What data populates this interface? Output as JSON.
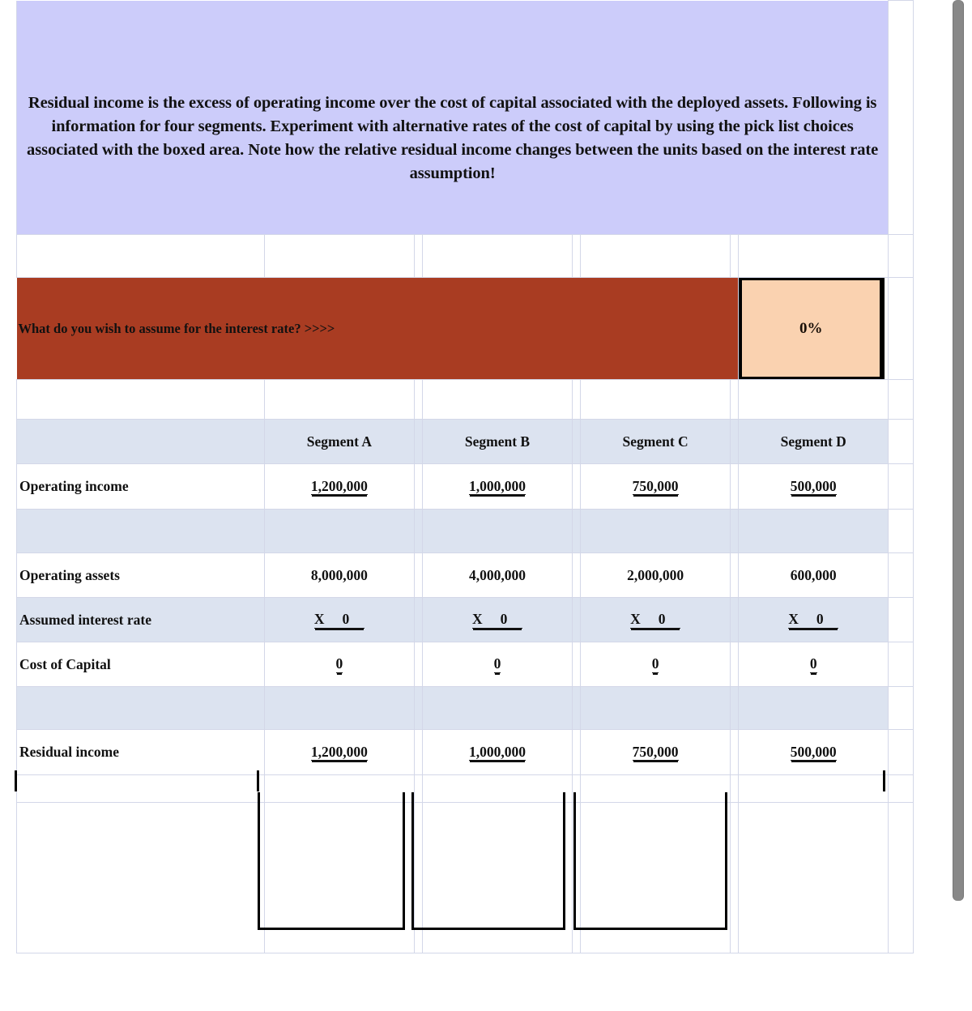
{
  "colors": {
    "banner_bg": "#CCCCFA",
    "question_band_bg": "#A93C22",
    "input_box_bg": "#FAD2B0",
    "shaded_row_bg": "#DCE3F0",
    "grid_line": "#D3D7E8",
    "box_border": "#000000"
  },
  "banner": {
    "text": "Residual income is the excess of operating income over the cost of capital associated with the deployed assets.  Following is information for four segments.  Experiment with alternative rates of the cost of capital by using the pick list choices associated with the boxed area.  Note how the relative residual income changes between the units based on the interest rate assumption!"
  },
  "question_row": {
    "prompt": "What do you wish to assume for the interest rate?  >>>>",
    "input_value": "0%"
  },
  "table": {
    "column_headers": [
      "",
      "Segment A",
      "Segment B",
      "Segment C",
      "Segment D"
    ],
    "rows": [
      {
        "label": "Operating income",
        "values": [
          "1,200,000",
          "1,000,000",
          "750,000",
          "500,000"
        ],
        "style": "double-underline"
      },
      {
        "label": "Operating assets",
        "values": [
          "8,000,000",
          "4,000,000",
          "2,000,000",
          "600,000"
        ],
        "style": "plain"
      },
      {
        "label": "Assumed interest rate",
        "values": [
          "0",
          "0",
          "0",
          "0"
        ],
        "multiplier_symbol": "X",
        "style": "double-underline"
      },
      {
        "label": "Cost of Capital",
        "values": [
          "0",
          "0",
          "0",
          "0"
        ],
        "style": "double-underline"
      },
      {
        "label": "Residual income",
        "values": [
          "1,200,000",
          "1,000,000",
          "750,000",
          "500,000"
        ],
        "style": "double-underline"
      }
    ]
  }
}
